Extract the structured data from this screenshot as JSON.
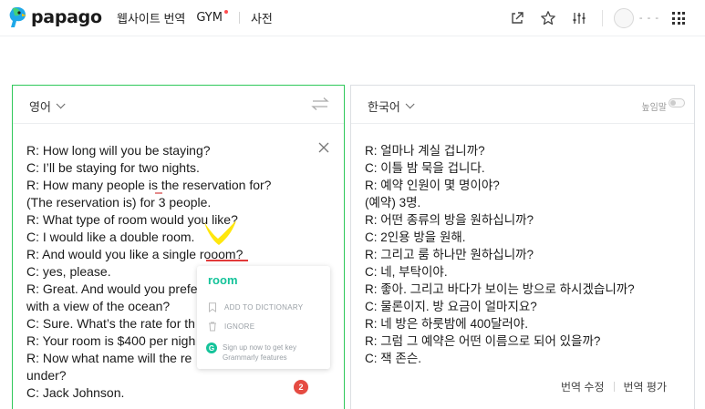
{
  "header": {
    "logo_text": "papago",
    "nav": {
      "website_translate": "웹사이트 번역",
      "gym": "GYM",
      "dictionary": "사전"
    },
    "user_name": "- - -",
    "icons": [
      "share-icon",
      "star-icon",
      "equalizer-icon",
      "avatar",
      "apps-grid-icon"
    ]
  },
  "source_panel": {
    "language": "영어",
    "lines": [
      "R: How long will you be staying?",
      "C: I’ll be staying for two nights.",
      "R: How many people is the reservation for?",
      "(The reservation is) for 3 people.",
      "R: What type of room would you like?",
      "C: I would like a double room.",
      "R: And would you like a single rooom?",
      "C: yes, please.",
      "R: Great. And would you prefe",
      "with a view of the ocean?",
      "C: Sure.  What’s the rate for th",
      "R: Your room is $400 per nigh",
      "R: Now what name will the re",
      "under?",
      "C: Jack Johnson."
    ]
  },
  "target_panel": {
    "language": "한국어",
    "honorific_label": "높임말",
    "lines": [
      "R: 얼마나 계실 겁니까?",
      "C: 이틀 밤 묵을 겁니다.",
      "R: 예약 인원이 몇 명이야?",
      "(예약) 3명.",
      "R: 어떤 종류의 방을 원하십니까?",
      "C: 2인용 방을 원해.",
      "R: 그리고 룸 하나만 원하십니까?",
      "C: 네, 부탁이야.",
      "R: 좋아. 그리고 바다가 보이는 방으로 하시겠습니까?",
      "C: 물론이지. 방 요금이 얼마지요?",
      "R: 네 방은 하룻밤에 400달러야.",
      "R: 그럼 그 예약은 어떤 이름으로 되어 있을까?",
      "C: 잭 존슨."
    ],
    "edit_label": "번역 수정",
    "rate_label": "번역 평가"
  },
  "grammarly": {
    "suggestion": "room",
    "add_to_dictionary": "ADD TO DICTIONARY",
    "ignore": "IGNORE",
    "signup_line1": "Sign up now to get key",
    "signup_line2": "Grammarly features",
    "badge_count": "2",
    "brand_color": "#15c39a"
  },
  "colors": {
    "accent_green": "#2fc85a",
    "error_red": "#e23a3a"
  }
}
